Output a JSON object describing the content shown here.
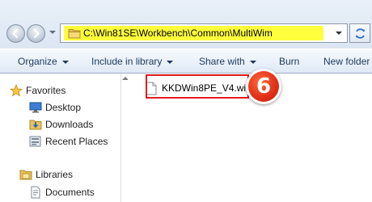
{
  "address_bar": {
    "path": "C:\\Win81SE\\Workbench\\Common\\MultiWim",
    "highlight_color": "#ffff3c"
  },
  "toolbar": {
    "organize_label": "Organize",
    "include_label": "Include in library",
    "share_label": "Share with",
    "burn_label": "Burn",
    "new_folder_label": "New folder"
  },
  "nav_pane": {
    "favorites": {
      "label": "Favorites",
      "items": [
        {
          "label": "Desktop",
          "icon": "desktop-icon"
        },
        {
          "label": "Downloads",
          "icon": "downloads-folder-icon"
        },
        {
          "label": "Recent Places",
          "icon": "recent-places-icon"
        }
      ]
    },
    "libraries": {
      "label": "Libraries",
      "items": [
        {
          "label": "Documents",
          "icon": "documents-icon"
        }
      ]
    }
  },
  "files": [
    {
      "name": "KKDWin8PE_V4.wim",
      "icon": "file-icon"
    }
  ],
  "annotation": {
    "step_number": "6",
    "color": "#e11c1c"
  }
}
